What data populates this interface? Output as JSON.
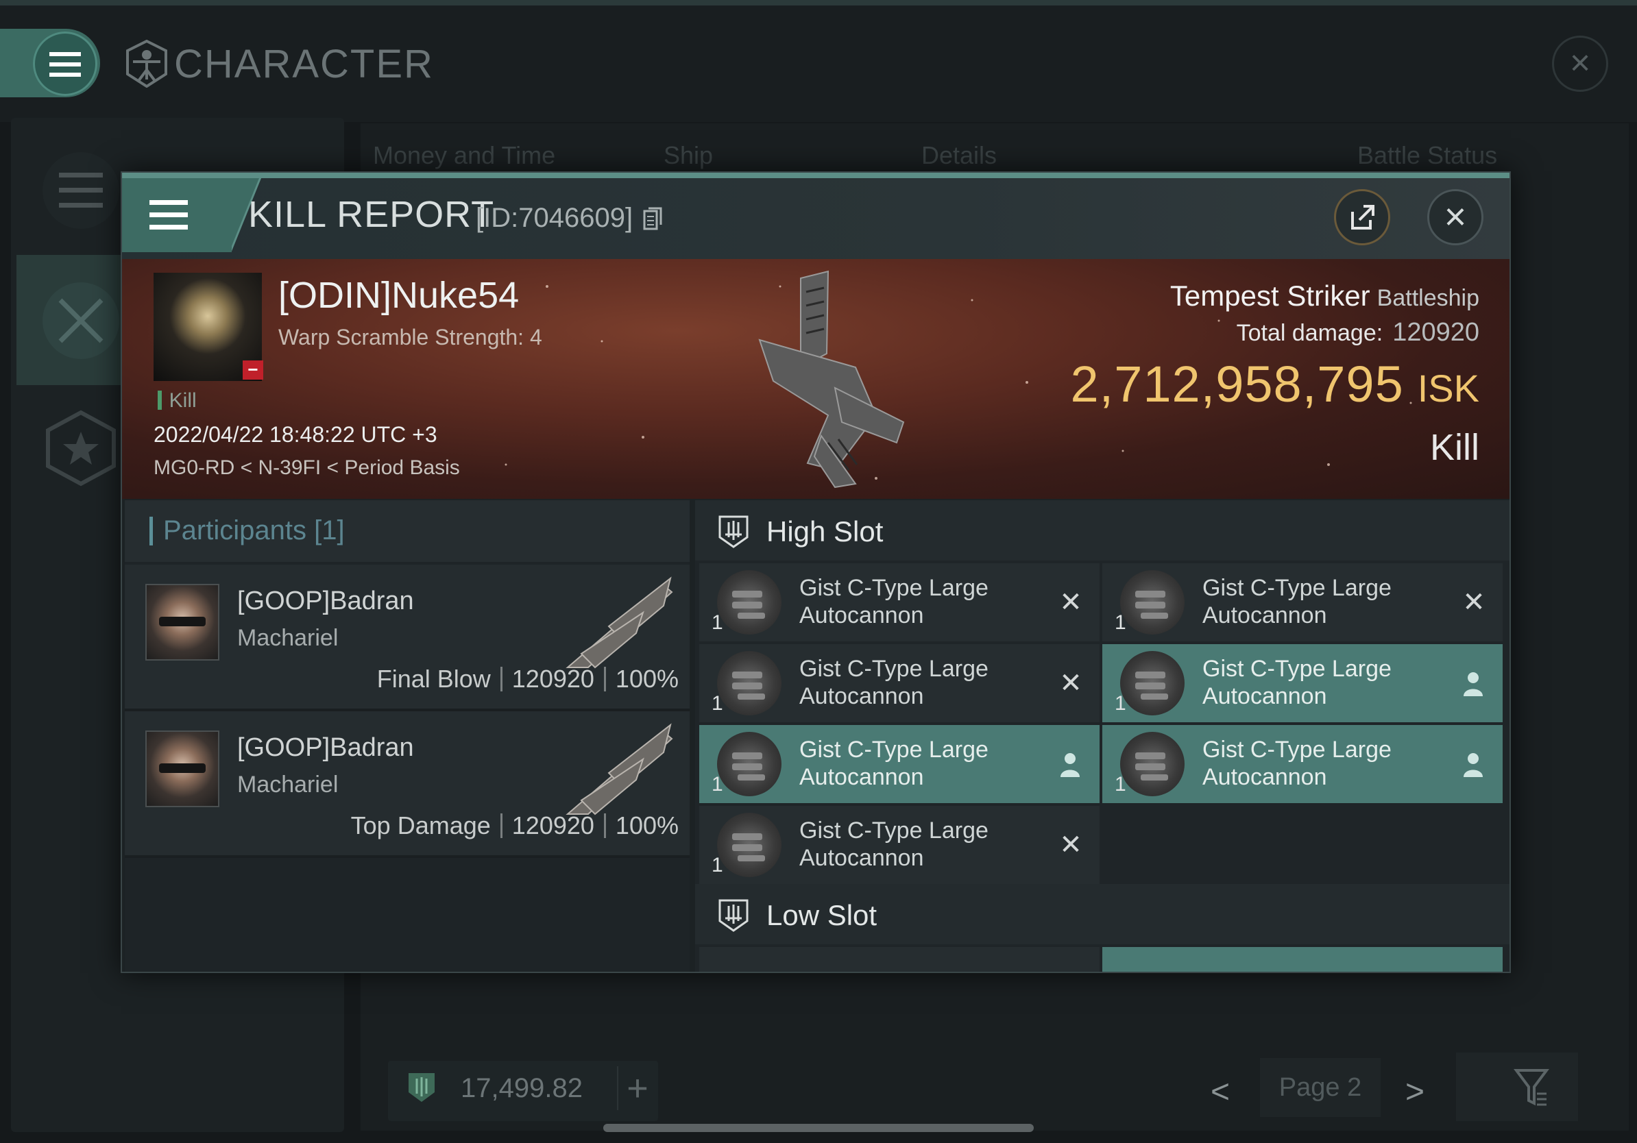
{
  "background": {
    "title": "CHARACTER",
    "tabs": [
      "Money and Time",
      "Ship",
      "Details",
      "Battle Status"
    ],
    "footer": {
      "balance": "17,499.82",
      "page": "Page 2"
    }
  },
  "modal": {
    "title": "KILL REPORT",
    "report_id": "[ID:7046609]",
    "victim": {
      "name": "[ODIN]Nuke54",
      "subtitle": "Warp Scramble Strength: 4",
      "tag": "Kill",
      "time": "2022/04/22 18:48:22 UTC +3",
      "location": "MG0-RD < N-39FI < Period Basis"
    },
    "ship": {
      "name": "Tempest Striker",
      "class": "Battleship",
      "damage_label": "Total damage:",
      "damage_value": "120920",
      "isk_value": "2,712,958,795",
      "isk_unit": "ISK",
      "result": "Kill"
    },
    "participants": {
      "title": "Participants [1]",
      "rows": [
        {
          "name": "[GOOP]Badran",
          "ship": "Machariel",
          "role": "Final Blow",
          "damage": "120920",
          "percent": "100%"
        },
        {
          "name": "[GOOP]Badran",
          "ship": "Machariel",
          "role": "Top Damage",
          "damage": "120920",
          "percent": "100%"
        }
      ]
    },
    "slots": {
      "high_label": "High Slot",
      "low_label": "Low Slot",
      "modules": [
        {
          "name": "Gist C-Type Large Autocannon",
          "qty": "1",
          "status": "destroyed"
        },
        {
          "name": "Gist C-Type Large Autocannon",
          "qty": "1",
          "status": "destroyed"
        },
        {
          "name": "Gist C-Type Large Autocannon",
          "qty": "1",
          "status": "destroyed"
        },
        {
          "name": "Gist C-Type Large Autocannon",
          "qty": "1",
          "status": "dropped"
        },
        {
          "name": "Gist C-Type Large Autocannon",
          "qty": "1",
          "status": "dropped"
        },
        {
          "name": "Gist C-Type Large Autocannon",
          "qty": "1",
          "status": "dropped"
        },
        {
          "name": "Gist C-Type Large Autocannon",
          "qty": "1",
          "status": "destroyed"
        }
      ],
      "status_glyphs": {
        "destroyed": "✕"
      }
    },
    "colors": {
      "accent": "#4a7a74",
      "isk": "#f0c56e",
      "flag": "#c0202a"
    }
  }
}
